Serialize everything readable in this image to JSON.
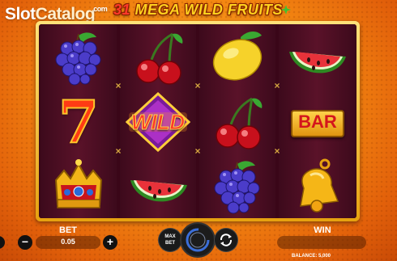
{
  "watermark": {
    "slot": "Slot",
    "catalog": "Catalog",
    "com": "com"
  },
  "game": {
    "title_number": "31",
    "title_text": "MEGA WILD FRUITS"
  },
  "reels": [
    [
      "grapes-icon",
      "seven-icon",
      "crown-icon"
    ],
    [
      "cherries-icon",
      "wild-symbol",
      "watermelon-icon"
    ],
    [
      "lemon-icon",
      "cherries-icon",
      "grapes-icon"
    ],
    [
      "watermelon-icon",
      "bar-symbol",
      "bell-icon"
    ]
  ],
  "symbols": {
    "wild_label": "WILD",
    "bar_label": "BAR",
    "seven_label": "7"
  },
  "controls": {
    "bet_label": "BET",
    "bet_value": "0.05",
    "minus": "−",
    "plus": "+",
    "max_bet_line1": "MAX",
    "max_bet_line2": "BET",
    "win_label": "WIN",
    "balance": "BALANCE: 5,000"
  },
  "colors": {
    "background": "#f58a12",
    "frame": "#e6a10f",
    "reel_bg": "#4a0d22"
  }
}
